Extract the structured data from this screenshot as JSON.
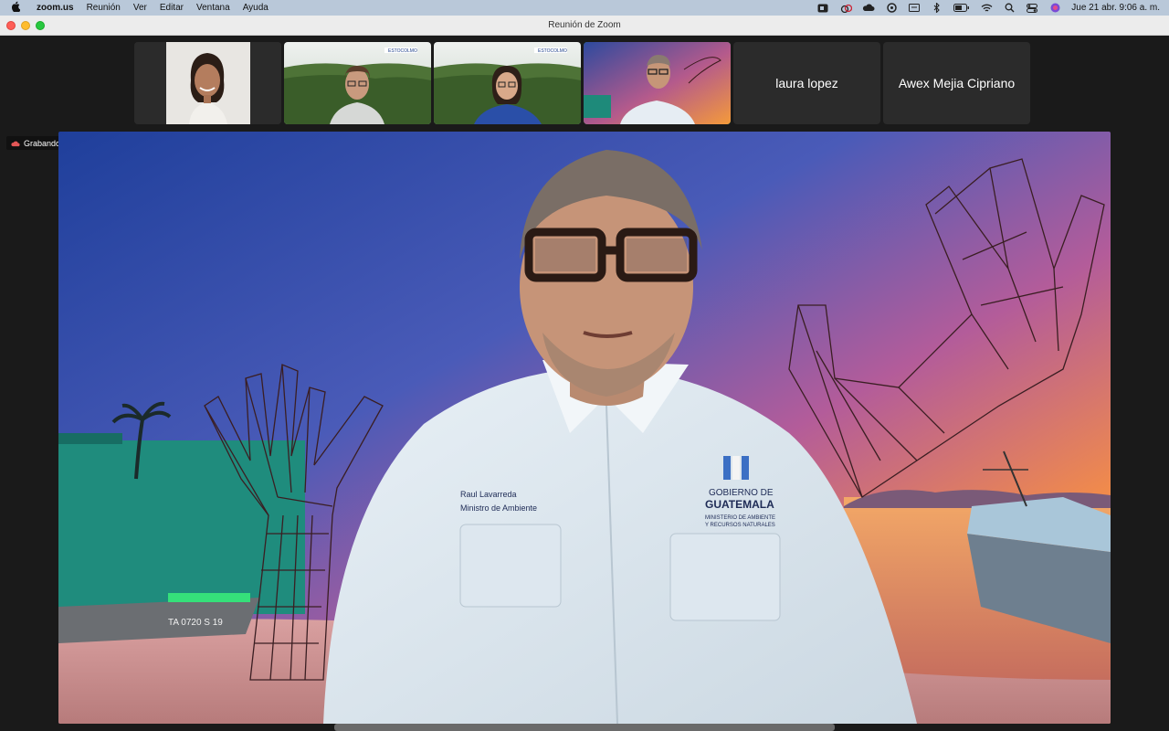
{
  "menubar": {
    "app_name": "zoom.us",
    "menus": [
      "Reunión",
      "Ver",
      "Editar",
      "Ventana",
      "Ayuda"
    ],
    "status_icons": [
      "zoom-icon",
      "creative-cloud-icon",
      "cloud-icon",
      "sync-icon",
      "display-icon",
      "bluetooth-icon",
      "battery-icon",
      "wifi-icon",
      "spotlight-search-icon",
      "control-center-icon",
      "siri-icon"
    ],
    "clock": "Jue 21 abr.  9:06 a. m."
  },
  "window": {
    "title": "Reunión de Zoom"
  },
  "gallery": {
    "participants": [
      {
        "type": "video",
        "icon": "participant-video-woman-icon"
      },
      {
        "type": "video",
        "icon": "participant-video-man-glasses-icon",
        "background_label": "ESTOCOLMO"
      },
      {
        "type": "video",
        "icon": "participant-video-woman-glasses-icon",
        "background_label": "ESTOCOLMO"
      },
      {
        "type": "video",
        "icon": "participant-video-active-speaker-icon",
        "active": true
      },
      {
        "type": "name",
        "name": "laura lopez"
      },
      {
        "type": "name",
        "name": "Awex Mejia Cipriano"
      }
    ],
    "next_icon": "chevron-right-icon"
  },
  "recording": {
    "label": "Grabando..."
  },
  "main_video": {
    "shirt_text_left": [
      "Raul Lavarreda",
      "Ministro de Ambiente"
    ],
    "shirt_logo": [
      "GOBIERNO DE",
      "GUATEMALA",
      "MINISTERIO DE AMBIENTE",
      "Y RECURSOS NATURALES"
    ],
    "boat_text": "TA 0720 S 19"
  },
  "colors": {
    "active_speaker_border": "#2ec75a",
    "menubar_bg": "#b9c8d9",
    "meeting_bg": "#1a1a1a"
  }
}
